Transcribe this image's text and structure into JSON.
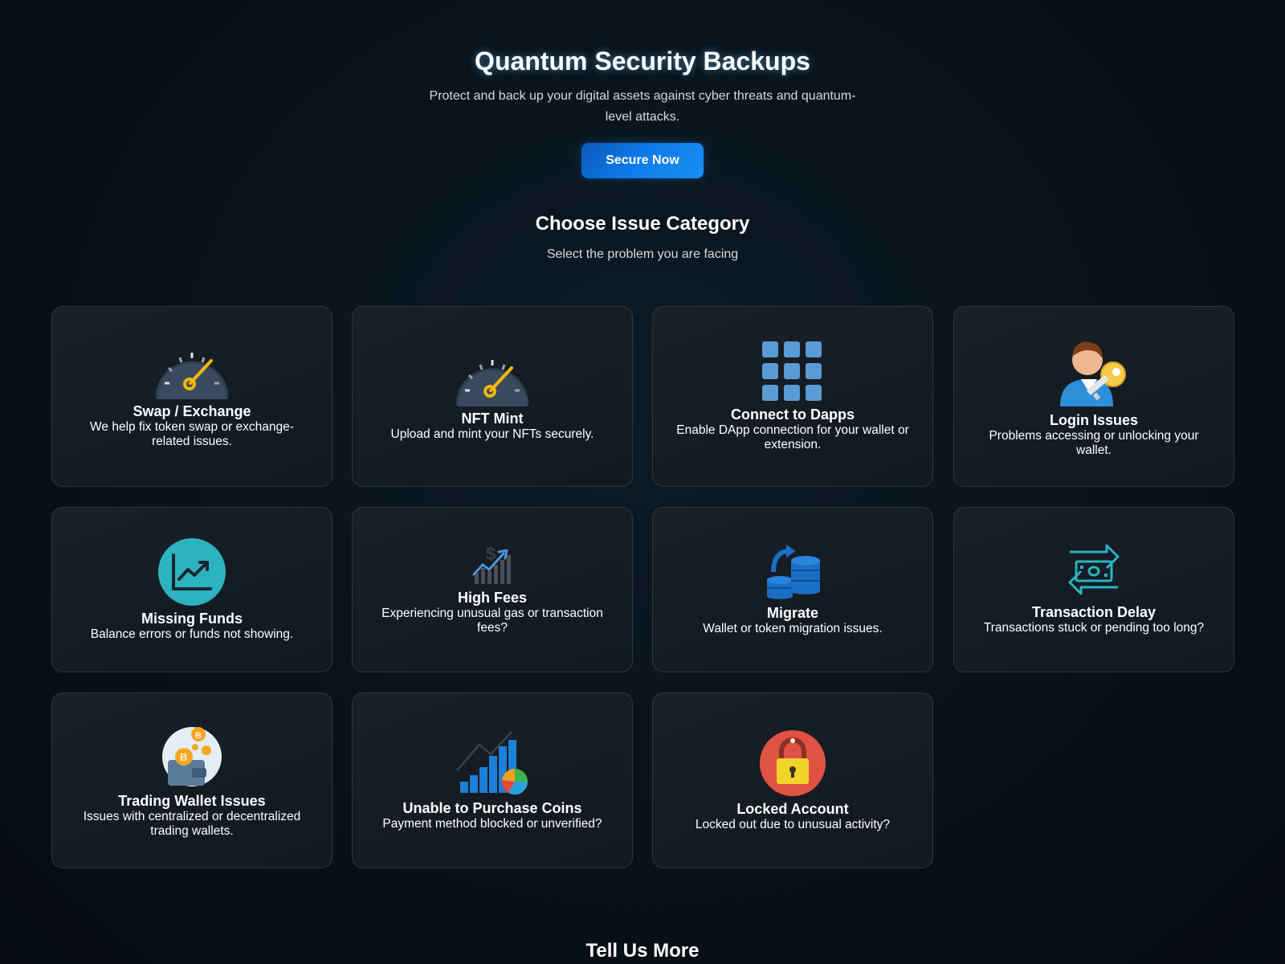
{
  "hero": {
    "title": "Quantum Security Backups",
    "subtitle": "Protect and back up your digital assets against cyber threats and quantum-level attacks.",
    "cta_label": "Secure Now"
  },
  "categories_section": {
    "title": "Choose Issue Category",
    "subtitle": "Select the problem you are facing"
  },
  "cards": [
    {
      "title": "Swap / Exchange",
      "description": "We help fix token swap or exchange-related issues.",
      "icon": "speedometer-icon"
    },
    {
      "title": "NFT Mint",
      "description": "Upload and mint your NFTs securely.",
      "icon": "speedometer-icon"
    },
    {
      "title": "Connect to Dapps",
      "description": "Enable DApp connection for your wallet or extension.",
      "icon": "app-grid-icon"
    },
    {
      "title": "Login Issues",
      "description": "Problems accessing or unlocking your wallet.",
      "icon": "user-key-icon"
    },
    {
      "title": "Missing Funds",
      "description": "Balance errors or funds not showing.",
      "icon": "chart-circle-icon"
    },
    {
      "title": "High Fees",
      "description": "Experiencing unusual gas or transaction fees?",
      "icon": "dollar-chart-icon"
    },
    {
      "title": "Migrate",
      "description": "Wallet or token migration issues.",
      "icon": "database-migrate-icon"
    },
    {
      "title": "Transaction Delay",
      "description": "Transactions stuck or pending too long?",
      "icon": "money-transfer-icon"
    },
    {
      "title": "Trading Wallet Issues",
      "description": "Issues with centralized or decentralized trading wallets.",
      "icon": "wallet-coins-icon"
    },
    {
      "title": "Unable to Purchase Coins",
      "description": "Payment method blocked or unverified?",
      "icon": "bar-pie-chart-icon"
    },
    {
      "title": "Locked Account",
      "description": "Locked out due to unusual activity?",
      "icon": "padlock-icon"
    }
  ],
  "footer_section": {
    "title": "Tell Us More"
  },
  "colors": {
    "background": "#08121a",
    "card_bg": "#161d24",
    "card_border": "#2c3642",
    "accent_blue": "#0d79e8",
    "gauge_needle": "#f5b800",
    "icon_blue": "#5b9bd5",
    "teal": "#2bb3c0",
    "lock_red": "#e74c3c",
    "lock_yellow": "#f1d32a"
  }
}
